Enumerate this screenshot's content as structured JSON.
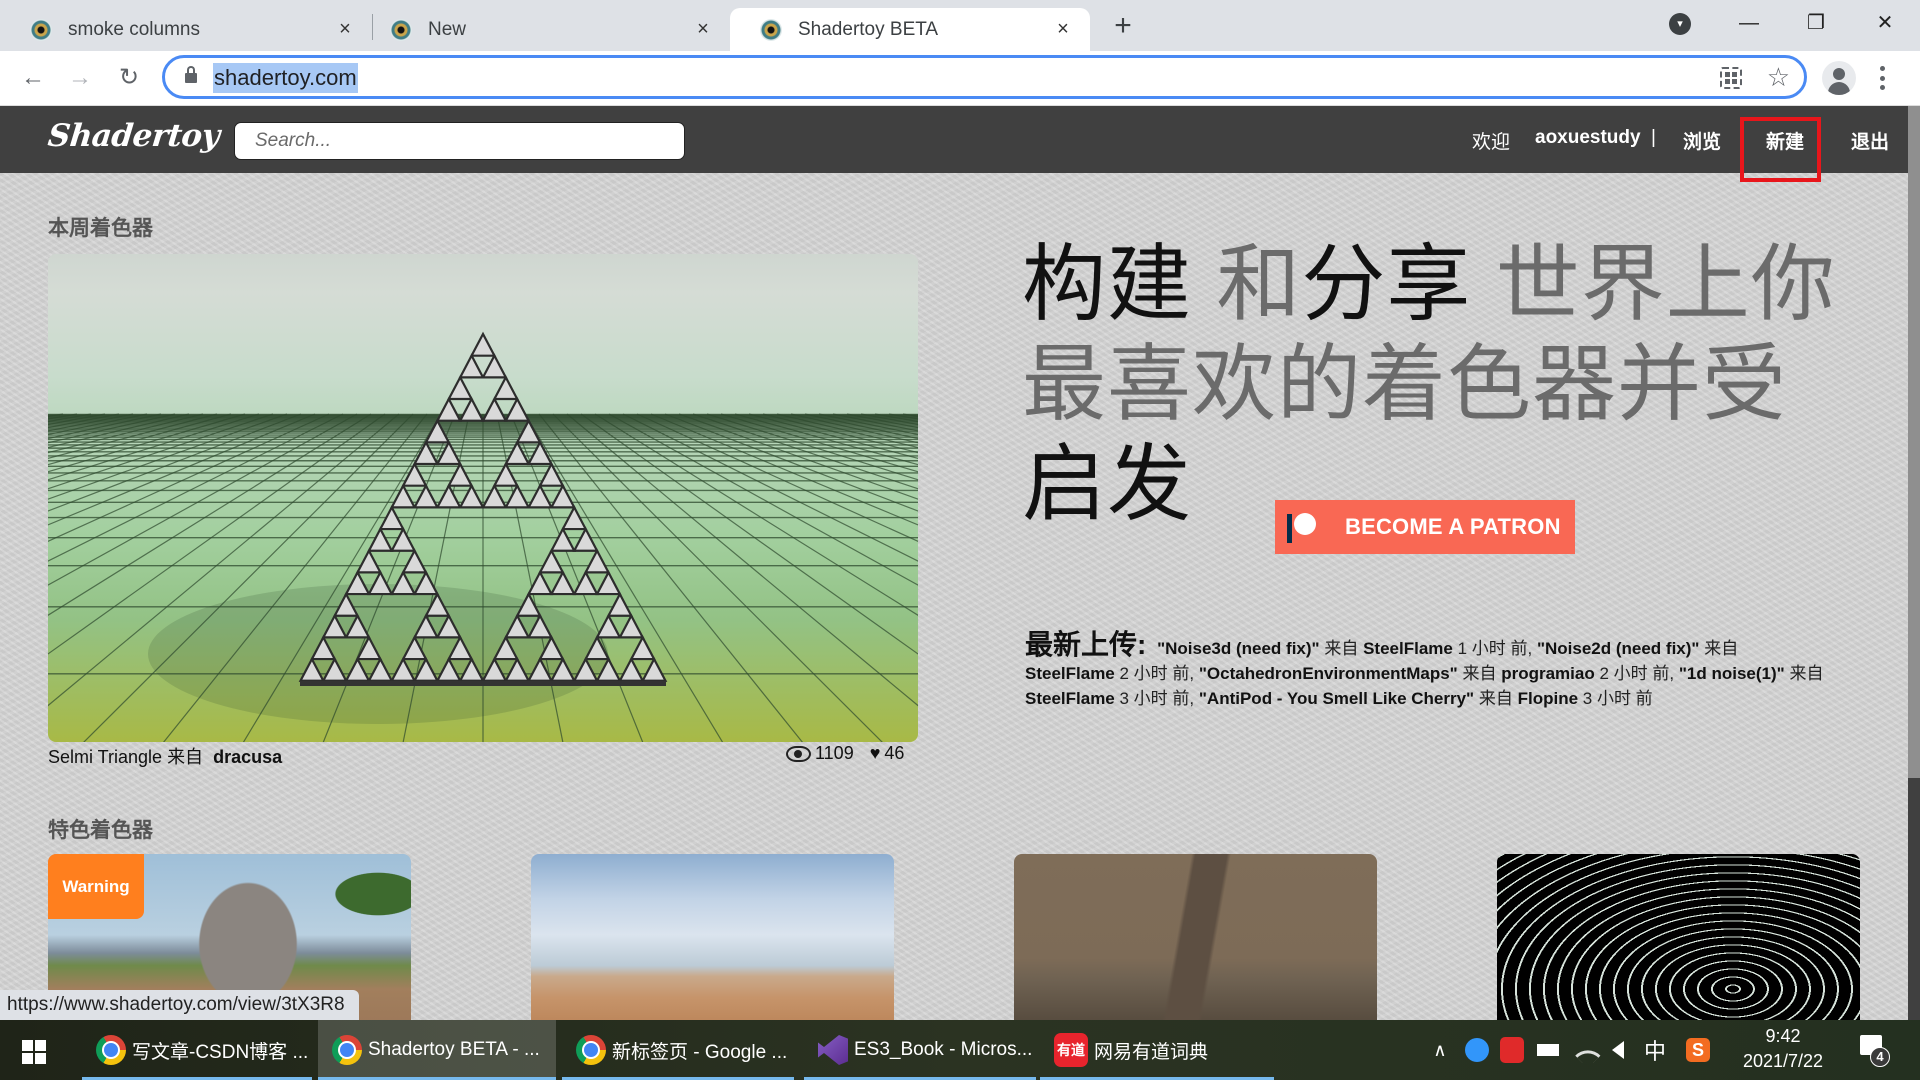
{
  "browser": {
    "tabs": [
      {
        "title": "smoke columns",
        "active": false
      },
      {
        "title": "New",
        "active": false
      },
      {
        "title": "Shadertoy BETA",
        "active": true
      }
    ],
    "tab_close_glyph": "×",
    "new_tab_glyph": "+",
    "tab_search_glyph": "▾",
    "window_controls": {
      "minimize": "—",
      "restore": "❐",
      "close": "✕"
    },
    "nav": {
      "back": "←",
      "forward": "→",
      "reload": "↻"
    },
    "url": "shadertoy.com",
    "star_glyph": "☆",
    "status_url": "https://www.shadertoy.com/view/3tX3R8"
  },
  "site": {
    "logo": "Shadertoy",
    "search_placeholder": "Search...",
    "nav": {
      "welcome": "欢迎",
      "username": "aoxuestudy",
      "separator": "|",
      "browse": "浏览",
      "new": "新建",
      "logout": "退出"
    },
    "highlight_color": "#e8161b"
  },
  "weekly": {
    "section_title": "本周着色器",
    "shader_name": "Selmi Triangle",
    "by": "来自",
    "author": "dracusa",
    "views": "1109",
    "likes": "46",
    "heart_glyph": "♥"
  },
  "hero": {
    "parts": [
      {
        "text": "构建",
        "emphasis": true
      },
      {
        "text": " 和",
        "emphasis": false
      },
      {
        "text": "分享",
        "emphasis": true
      },
      {
        "text": " 世界上你最喜欢的着色器并受 ",
        "emphasis": false
      },
      {
        "text": "启发",
        "emphasis": true
      }
    ]
  },
  "patron": {
    "label": "BECOME A PATRON",
    "color": "#f96854"
  },
  "recent": {
    "title": "最新上传:",
    "items": [
      {
        "name": "\"Noise3d (need fix)\"",
        "by": "来自",
        "author": "SteelFlame",
        "time": "1 小时 前"
      },
      {
        "name": "\"Noise2d (need fix)\"",
        "by": "来自",
        "author": "SteelFlame",
        "time": "2 小时 前"
      },
      {
        "name": "\"OctahedronEnvironmentMaps\"",
        "by": "来自",
        "author": "programiao",
        "time": "2 小时 前"
      },
      {
        "name": "\"1d noise(1)\"",
        "by": "来自",
        "author": "SteelFlame",
        "time": "3 小时 前"
      },
      {
        "name": "\"AntiPod - You Smell Like Cherry\"",
        "by": "来自",
        "author": "Flopine",
        "time": "3 小时 前"
      }
    ]
  },
  "featured": {
    "section_title": "特色着色器",
    "thumbnails": [
      {
        "badge": "Warning",
        "subject": "elephant"
      },
      {
        "badge": null,
        "subject": "desert-sky"
      },
      {
        "badge": null,
        "subject": "rock-spire"
      },
      {
        "badge": null,
        "subject": "wire-tunnel"
      }
    ],
    "badge_color": "#ff7f1e"
  },
  "scroll": {
    "position_fraction": 0.0,
    "visible_fraction": 0.74
  },
  "taskbar": {
    "apps": [
      {
        "label": "写文章-CSDN博客 ...",
        "icon": "chrome",
        "active": false
      },
      {
        "label": "Shadertoy BETA - ...",
        "icon": "chrome",
        "active": true
      },
      {
        "label": "新标签页 - Google ...",
        "icon": "chrome",
        "active": false
      },
      {
        "label": "ES3_Book - Micros...",
        "icon": "visual-studio",
        "active": false
      },
      {
        "label": "网易有道词典",
        "icon": "youdao",
        "active": false
      }
    ],
    "youdao_icon_text": "有道",
    "tray": {
      "chevron": "∧",
      "ime": "中",
      "sogou": "S"
    },
    "time": "9:42",
    "date": "2021/7/22",
    "notifications": "4"
  }
}
